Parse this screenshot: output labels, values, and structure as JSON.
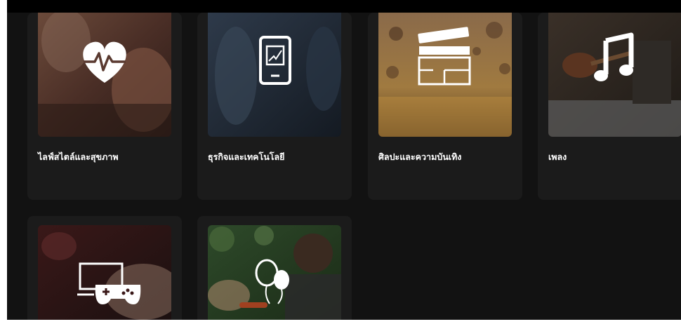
{
  "categories": [
    {
      "label": "ไลฟ์สไตล์และสุขภาพ",
      "icon": "heartbeat-icon"
    },
    {
      "label": "ธุรกิจและเทคโนโลยี",
      "icon": "tablet-chart-icon"
    },
    {
      "label": "ศิลปะและความบันเทิง",
      "icon": "clapperboard-icon"
    },
    {
      "label": "เพลง",
      "icon": "music-note-icon"
    },
    {
      "label": "",
      "icon": "game-controller-icon"
    },
    {
      "label": "",
      "icon": "balloons-icon"
    }
  ],
  "colors": {
    "background": "#121212",
    "card": "#1b1b1b",
    "text": "#ffffff"
  }
}
